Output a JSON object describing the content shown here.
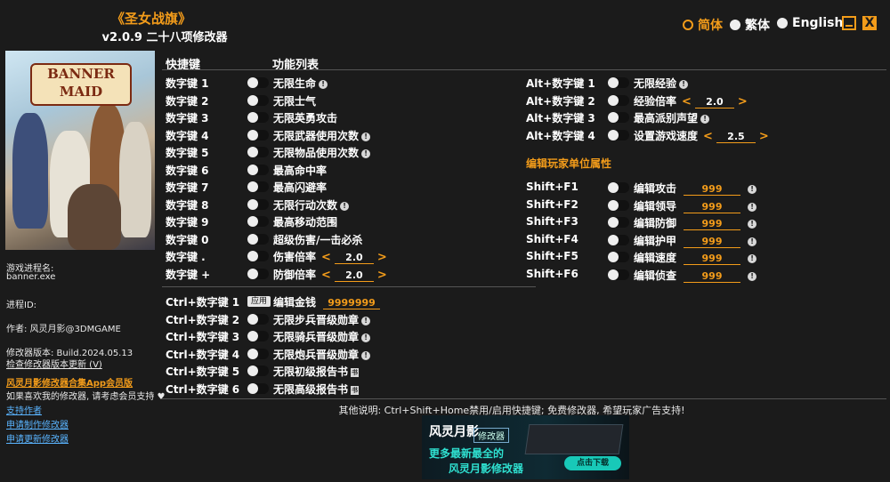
{
  "header": {
    "title": "《圣女战旗》",
    "subtitle": "v2.0.9 二十八项修改器",
    "languages": [
      {
        "label": "简体",
        "selected": true
      },
      {
        "label": "繁体",
        "selected": false
      },
      {
        "label": "English",
        "selected": false
      }
    ],
    "close_glyph": "X"
  },
  "sidebar": {
    "cover_logo_line1": "BANNER",
    "cover_logo_line2": "MAID",
    "process_name_label": "游戏进程名:",
    "process_name": "banner.exe",
    "process_id_label": "进程ID:",
    "author": "作者: 风灵月影@3DMGAME",
    "version": "修改器版本: Build.2024.05.13",
    "check_update": "检查修改器版本更新 (V)",
    "app_member": "风灵月影修改器合集App会员版",
    "support_text": "如果喜欢我的修改器, 请考虑会员支持",
    "links": [
      "支持作者",
      "申请制作修改器",
      "申请更新修改器"
    ]
  },
  "columns": {
    "hotkey": "快捷键",
    "features": "功能列表"
  },
  "left_rows": [
    {
      "key": "数字键 1",
      "label": "无限生命",
      "mark": "bang"
    },
    {
      "key": "数字键 2",
      "label": "无限士气",
      "mark": ""
    },
    {
      "key": "数字键 3",
      "label": "无限英勇攻击",
      "mark": ""
    },
    {
      "key": "数字键 4",
      "label": "无限武器使用次数",
      "mark": "bang"
    },
    {
      "key": "数字键 5",
      "label": "无限物品使用次数",
      "mark": "bang"
    },
    {
      "key": "数字键 6",
      "label": "最高命中率",
      "mark": ""
    },
    {
      "key": "数字键 7",
      "label": "最高闪避率",
      "mark": ""
    },
    {
      "key": "数字键 8",
      "label": "无限行动次数",
      "mark": "bang"
    },
    {
      "key": "数字键 9",
      "label": "最高移动范围",
      "mark": ""
    },
    {
      "key": "数字键 0",
      "label": "超级伤害/一击必杀",
      "mark": ""
    },
    {
      "key": "数字键 .",
      "label": "伤害倍率",
      "mark": "",
      "value": "2.0"
    },
    {
      "key": "数字键 +",
      "label": "防御倍率",
      "mark": "",
      "value": "2.0"
    }
  ],
  "ctrl_rows": [
    {
      "key": "Ctrl+数字键 1",
      "label": "编辑金钱",
      "apply": "应用",
      "value": "9999999"
    },
    {
      "key": "Ctrl+数字键 2",
      "label": "无限步兵晋级勋章",
      "mark": "bang"
    },
    {
      "key": "Ctrl+数字键 3",
      "label": "无限骑兵晋级勋章",
      "mark": "bang"
    },
    {
      "key": "Ctrl+数字键 4",
      "label": "无限炮兵晋级勋章",
      "mark": "bang"
    },
    {
      "key": "Ctrl+数字键 5",
      "label": "无限初级报告书",
      "mark": "book"
    },
    {
      "key": "Ctrl+数字键 6",
      "label": "无限高级报告书",
      "mark": "book"
    }
  ],
  "alt_rows": [
    {
      "key": "Alt+数字键 1",
      "label": "无限经验",
      "mark": "bang"
    },
    {
      "key": "Alt+数字键 2",
      "label": "经验倍率",
      "value": "2.0"
    },
    {
      "key": "Alt+数字键 3",
      "label": "最高派别声望",
      "mark": "bang"
    },
    {
      "key": "Alt+数字键 4",
      "label": "设置游戏速度",
      "value": "2.5"
    }
  ],
  "unit_section_title": "编辑玩家单位属性",
  "shift_rows": [
    {
      "key": "Shift+F1",
      "label": "编辑攻击",
      "value": "999"
    },
    {
      "key": "Shift+F2",
      "label": "编辑领导",
      "value": "999"
    },
    {
      "key": "Shift+F3",
      "label": "编辑防御",
      "value": "999"
    },
    {
      "key": "Shift+F4",
      "label": "编辑护甲",
      "value": "999"
    },
    {
      "key": "Shift+F5",
      "label": "编辑速度",
      "value": "999"
    },
    {
      "key": "Shift+F6",
      "label": "编辑侦查",
      "value": "999"
    }
  ],
  "footer": {
    "note": "其他说明: Ctrl+Shift+Home禁用/启用快捷键; 免费修改器, 希望玩家广告支持!",
    "banner_brand": "风灵月影",
    "banner_tag": "修改器",
    "banner_line1": "更多最新最全的",
    "banner_line2": "风灵月影修改器",
    "banner_button": "点击下载"
  },
  "colors": {
    "accent": "#f39c1a",
    "background": "#1b1b1b",
    "link": "#5ab4ff"
  }
}
